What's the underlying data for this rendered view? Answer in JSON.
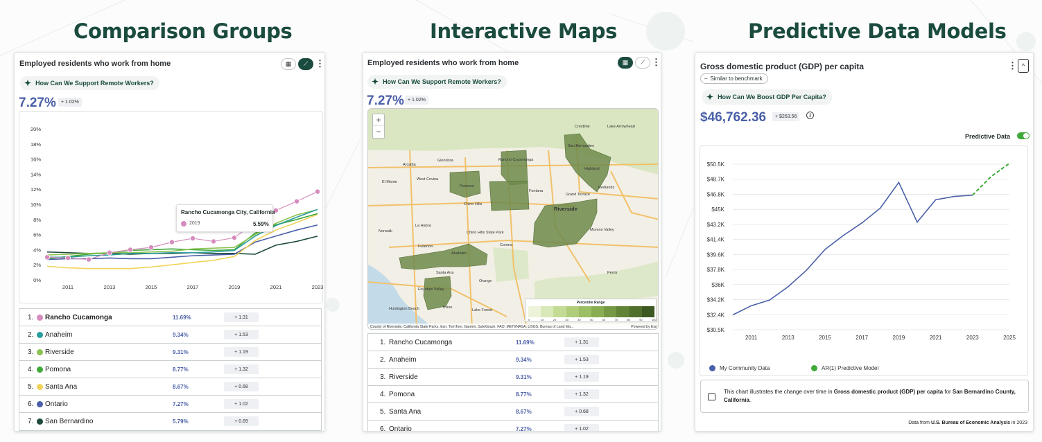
{
  "headings": {
    "left": "Comparison Groups",
    "middle": "Interactive Maps",
    "right": "Predictive Data Models"
  },
  "colors": {
    "brand_green": "#1b4b3f",
    "value_blue": "#4a5fa8",
    "pink": "#d68bbd",
    "teal": "#2a9d9d",
    "lightgreen": "#8dc152",
    "green": "#3fa93a",
    "yellow": "#f2d35a",
    "blue": "#4a5fa8",
    "darkgreen": "#1d4a3c"
  },
  "left_card": {
    "title": "Employed residents who work from home",
    "prompt": "How Can We Support Remote Workers?",
    "value": "7.27%",
    "change": "+ 1.02%",
    "tooltip": {
      "title": "Rancho Cucamonga City, California",
      "year": "2019",
      "value": "5.59%"
    },
    "ranking": [
      {
        "rank": "1.",
        "name": "Rancho Cucamonga",
        "pct": "11.69%",
        "delta": "+ 1.31",
        "color": "#d68bbd",
        "bold": true
      },
      {
        "rank": "2.",
        "name": "Anaheim",
        "pct": "9.34%",
        "delta": "+ 1.53",
        "color": "#2a9d9d",
        "bold": false
      },
      {
        "rank": "3.",
        "name": "Riverside",
        "pct": "9.31%",
        "delta": "+ 1.19",
        "color": "#8dc152",
        "bold": false
      },
      {
        "rank": "4.",
        "name": "Pomona",
        "pct": "8.77%",
        "delta": "+ 1.32",
        "color": "#3fa93a",
        "bold": false
      },
      {
        "rank": "5.",
        "name": "Santa Ana",
        "pct": "8.67%",
        "delta": "+ 0.68",
        "color": "#f2d35a",
        "bold": false
      },
      {
        "rank": "6.",
        "name": "Ontario",
        "pct": "7.27%",
        "delta": "+ 1.02",
        "color": "#4a5fa8",
        "bold": false
      },
      {
        "rank": "7.",
        "name": "San Bernardino",
        "pct": "5.79%",
        "delta": "+ 0.69",
        "color": "#1d4a3c",
        "bold": false
      }
    ]
  },
  "middle_card": {
    "title": "Employed residents who work from home",
    "prompt": "How Can We Support Remote Workers?",
    "value": "7.27%",
    "change": "+ 1.02%",
    "zoom_in": "+",
    "zoom_out": "−",
    "map_attribution": "County of Riverside, California State Parks, Esri, TomTom, Garmin, SafeGraph, FAO, METI/NASA, USGS, Bureau of Land Ma...",
    "map_powered": "Powered by Esri",
    "legend_title": "Percentile Range",
    "legend_ticks": [
      "0",
      "10",
      "20",
      "30",
      "40",
      "50",
      "60",
      "70",
      "80",
      "90",
      "100"
    ],
    "place_labels": [
      "Arcadia",
      "Glendora",
      "El Monte",
      "West Covina",
      "Pomona",
      "Chino Hills",
      "Fontana",
      "Rancho Cucamonga",
      "San Bernardino",
      "Highland",
      "Redlands",
      "Grand Terrace",
      "Riverside",
      "Moreno Valley",
      "Norwalk",
      "La Habra",
      "Fullerton",
      "Anaheim",
      "Santa Ana",
      "Corona",
      "Perris",
      "Orange",
      "Huntington Beach",
      "Irvine",
      "Lake Forest",
      "Fountain Valley",
      "Crestline",
      "Lake Arrowhead",
      "Chino Hills State Park"
    ],
    "ranking": [
      {
        "rank": "1.",
        "name": "Rancho Cucamonga",
        "pct": "11.69%",
        "delta": "+ 1.31"
      },
      {
        "rank": "2.",
        "name": "Anaheim",
        "pct": "9.34%",
        "delta": "+ 1.53"
      },
      {
        "rank": "3.",
        "name": "Riverside",
        "pct": "9.31%",
        "delta": "+ 1.19"
      },
      {
        "rank": "4.",
        "name": "Pomona",
        "pct": "8.77%",
        "delta": "+ 1.32"
      },
      {
        "rank": "5.",
        "name": "Santa Ana",
        "pct": "8.67%",
        "delta": "+ 0.68"
      },
      {
        "rank": "6.",
        "name": "Ontario",
        "pct": "7.27%",
        "delta": "+ 1.02"
      }
    ]
  },
  "right_card": {
    "title": "Gross domestic product (GDP) per capita",
    "benchmark": "Similar to benchmark",
    "prompt": "How Can We Boost GDP Per Capita?",
    "value": "$46,762.36",
    "change": "+ $263.56",
    "predictive_label": "Predictive Data",
    "predictive_on": true,
    "legend": [
      {
        "label": "My Community Data",
        "color": "#4a5fa8"
      },
      {
        "label": "AR(1) Predictive Model",
        "color": "#3fa93a"
      }
    ],
    "note_prefix": "This chart illustrates the change over time in ",
    "note_metric": "Gross domestic product (GDP) per capita",
    "note_mid": " for ",
    "note_place": "San Bernardino County, California",
    "note_suffix": ".",
    "source_prefix": "Data from ",
    "source_name": "U.S. Bureau of Economic Analysis",
    "source_suffix": " in 2023"
  },
  "chart_data": [
    {
      "type": "line",
      "title": "Employed residents who work from home",
      "x": [
        2010,
        2011,
        2012,
        2013,
        2014,
        2015,
        2016,
        2017,
        2018,
        2019,
        2020,
        2021,
        2022,
        2023
      ],
      "xticks": [
        "2011",
        "2013",
        "2015",
        "2017",
        "2019",
        "2021",
        "2023"
      ],
      "yticks": [
        "0%",
        "2%",
        "4%",
        "6%",
        "8%",
        "10%",
        "12%",
        "14%",
        "16%",
        "18%",
        "20%"
      ],
      "ylim": [
        0,
        20
      ],
      "series": [
        {
          "name": "Rancho Cucamonga",
          "color": "#d68bbd",
          "markers": true,
          "values": [
            3.0,
            2.9,
            2.7,
            3.6,
            4.0,
            4.3,
            5.0,
            5.5,
            5.1,
            5.59,
            7.6,
            9.2,
            10.4,
            11.69
          ]
        },
        {
          "name": "Anaheim",
          "color": "#2a9d9d",
          "values": [
            3.0,
            3.0,
            3.2,
            3.3,
            3.5,
            3.5,
            3.6,
            3.6,
            3.7,
            3.9,
            5.8,
            7.2,
            8.3,
            9.34
          ]
        },
        {
          "name": "Riverside",
          "color": "#8dc152",
          "values": [
            3.3,
            3.4,
            3.5,
            3.6,
            3.6,
            3.7,
            3.8,
            4.1,
            4.2,
            4.3,
            6.0,
            7.5,
            8.6,
            9.31
          ]
        },
        {
          "name": "Pomona",
          "color": "#3fa93a",
          "values": [
            2.8,
            3.1,
            3.4,
            3.6,
            3.9,
            4.0,
            4.1,
            4.0,
            3.9,
            4.0,
            6.2,
            7.3,
            8.0,
            8.77
          ]
        },
        {
          "name": "Santa Ana",
          "color": "#f2d35a",
          "values": [
            1.8,
            1.6,
            1.5,
            1.5,
            1.5,
            1.7,
            2.0,
            2.3,
            2.6,
            3.1,
            5.2,
            6.6,
            7.6,
            8.67
          ]
        },
        {
          "name": "Ontario",
          "color": "#4a5fa8",
          "values": [
            2.7,
            2.8,
            2.8,
            2.9,
            2.8,
            2.8,
            3.0,
            3.2,
            3.3,
            3.4,
            5.0,
            5.8,
            6.6,
            7.27
          ]
        },
        {
          "name": "San Bernardino",
          "color": "#1d4a3c",
          "values": [
            3.7,
            3.6,
            3.5,
            3.5,
            3.4,
            3.5,
            3.5,
            3.6,
            3.5,
            3.5,
            3.4,
            4.6,
            5.1,
            5.79
          ]
        }
      ]
    },
    {
      "type": "line",
      "title": "Gross domestic product (GDP) per capita",
      "x": [
        2010,
        2011,
        2012,
        2013,
        2014,
        2015,
        2016,
        2017,
        2018,
        2019,
        2020,
        2021,
        2022,
        2023,
        2024,
        2025
      ],
      "xticks": [
        "2011",
        "2013",
        "2015",
        "2017",
        "2019",
        "2021",
        "2023",
        "2025"
      ],
      "yticks": [
        "$30.5K",
        "$32.4K",
        "$34.2K",
        "$36K",
        "$37.8K",
        "$39.6K",
        "$41.4K",
        "$43.2K",
        "$45K",
        "$46.8K",
        "$48.7K",
        "$50.5K"
      ],
      "ylim": [
        30.5,
        50.5
      ],
      "series": [
        {
          "name": "My Community Data",
          "color": "#4a5fa8",
          "x": [
            2010,
            2011,
            2012,
            2013,
            2014,
            2015,
            2016,
            2017,
            2018,
            2019,
            2020,
            2021,
            2022,
            2023
          ],
          "values": [
            32.3,
            33.4,
            34.1,
            35.7,
            37.7,
            40.2,
            41.9,
            43.4,
            45.2,
            48.3,
            43.5,
            46.2,
            46.6,
            46.76
          ]
        },
        {
          "name": "AR(1) Predictive Model",
          "color": "#3fa93a",
          "dashed": true,
          "x": [
            2023,
            2024,
            2025
          ],
          "values": [
            46.76,
            49.0,
            50.6
          ]
        }
      ]
    }
  ]
}
